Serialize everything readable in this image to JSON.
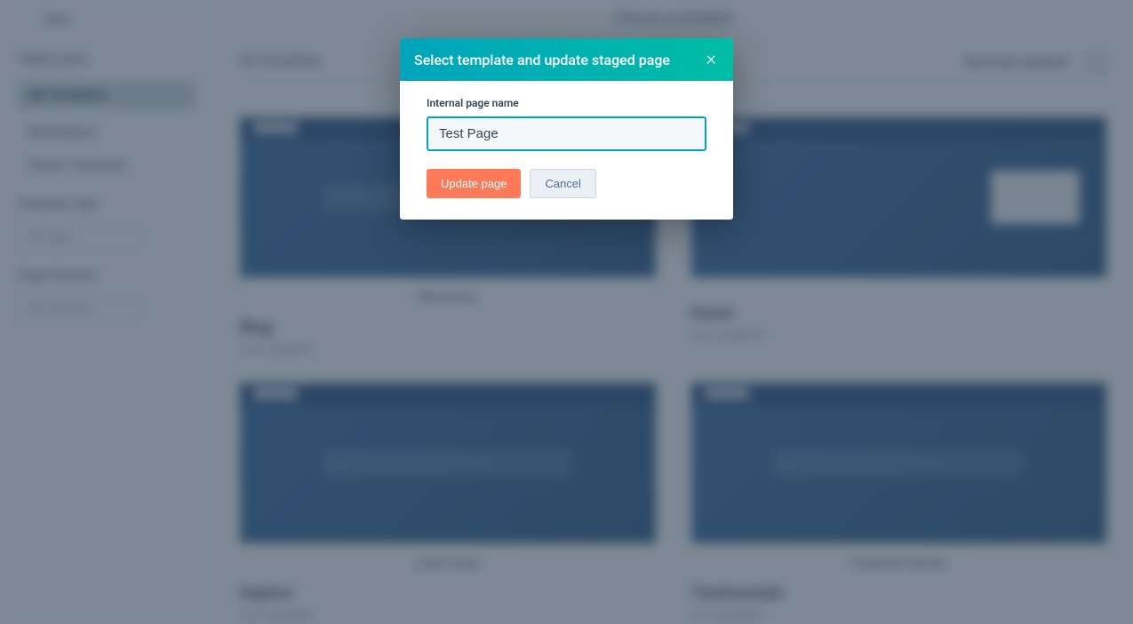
{
  "page_header": "Choose a template",
  "sidebar": {
    "back_label": "Back",
    "templates_heading": "TEMPLATES",
    "active_item": "My Templates",
    "items": [
      "Marketplace",
      "Starter Templates"
    ],
    "template_type_heading": "Template Type",
    "template_type_value": "All Types",
    "page_function_heading": "Page Function",
    "page_function_value": "All Functions"
  },
  "filters": {
    "left_label": "All Templates",
    "right_label": "Recently Updated"
  },
  "templates": [
    {
      "label": "Resources",
      "name": "Blog",
      "meta": "Last updated"
    },
    {
      "label": "",
      "name": "Home",
      "meta": "Last updated"
    },
    {
      "label": "Learn more",
      "name": "Explore",
      "meta": "Last updated"
    },
    {
      "label": "Customer Stories",
      "name": "Testimonials",
      "meta": "Last updated"
    }
  ],
  "modal": {
    "title": "Select template and update staged page",
    "input_label": "Internal page name",
    "input_value": "Test Page",
    "primary_button": "Update page",
    "secondary_button": "Cancel"
  }
}
